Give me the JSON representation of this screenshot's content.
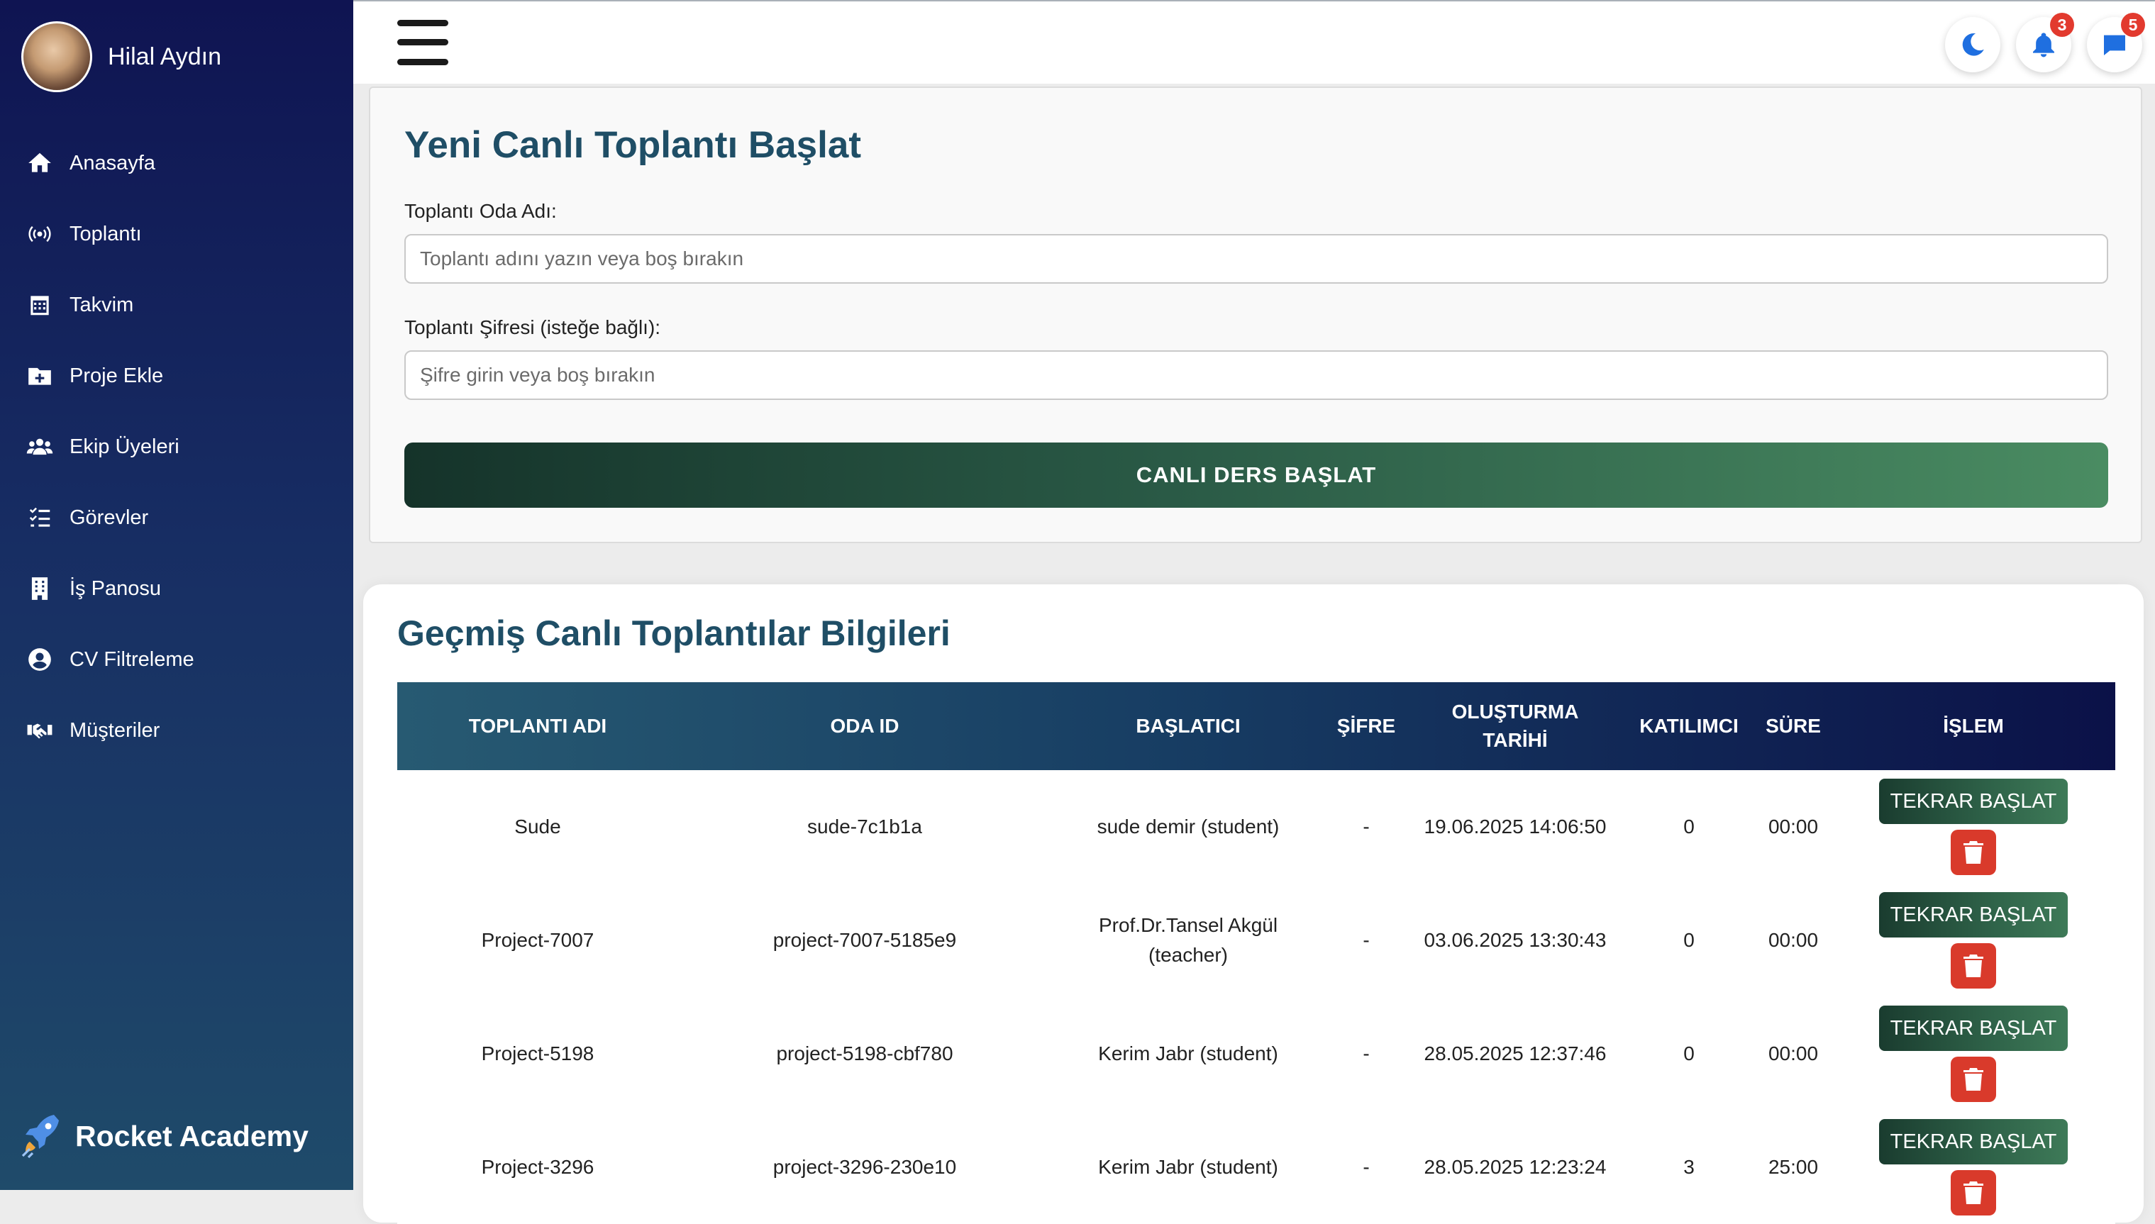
{
  "user": {
    "name": "Hilal Aydın"
  },
  "sidebar": {
    "items": [
      {
        "label": "Anasayfa",
        "icon": "home-icon"
      },
      {
        "label": "Toplantı",
        "icon": "broadcast-icon"
      },
      {
        "label": "Takvim",
        "icon": "calendar-icon"
      },
      {
        "label": "Proje Ekle",
        "icon": "folder-plus-icon"
      },
      {
        "label": "Ekip Üyeleri",
        "icon": "users-icon"
      },
      {
        "label": "Görevler",
        "icon": "task-list-icon"
      },
      {
        "label": "İş Panosu",
        "icon": "building-icon"
      },
      {
        "label": "CV Filtreleme",
        "icon": "user-circle-icon"
      },
      {
        "label": "Müşteriler",
        "icon": "handshake-icon"
      }
    ],
    "brand": "Rocket Academy"
  },
  "topbar": {
    "notifications_count": "3",
    "messages_count": "5"
  },
  "new_meeting": {
    "title": "Yeni Canlı Toplantı Başlat",
    "room_label": "Toplantı Oda Adı:",
    "room_placeholder": "Toplantı adını yazın veya boş bırakın",
    "room_value": "",
    "password_label": "Toplantı Şifresi (isteğe bağlı):",
    "password_placeholder": "Şifre girin veya boş bırakın",
    "password_value": "",
    "start_button": "CANLI DERS BAŞLAT"
  },
  "history": {
    "title": "Geçmiş Canlı Toplantılar Bilgileri",
    "columns": [
      "TOPLANTI ADI",
      "ODA ID",
      "BAŞLATICI",
      "ŞİFRE",
      "OLUŞTURMA TARİHİ",
      "KATILIMCI",
      "SÜRE",
      "İŞLEM"
    ],
    "restart_label": "TEKRAR BAŞLAT",
    "rows": [
      {
        "name": "Sude",
        "room_id": "sude-7c1b1a",
        "starter": "sude demir (student)",
        "password": "-",
        "created": "19.06.2025 14:06:50",
        "participants": "0",
        "duration": "00:00"
      },
      {
        "name": "Project-7007",
        "room_id": "project-7007-5185e9",
        "starter": "Prof.Dr.Tansel Akgül (teacher)",
        "password": "-",
        "created": "03.06.2025 13:30:43",
        "participants": "0",
        "duration": "00:00"
      },
      {
        "name": "Project-5198",
        "room_id": "project-5198-cbf780",
        "starter": "Kerim Jabr (student)",
        "password": "-",
        "created": "28.05.2025 12:37:46",
        "participants": "0",
        "duration": "00:00"
      },
      {
        "name": "Project-3296",
        "room_id": "project-3296-230e10",
        "starter": "Kerim Jabr (student)",
        "password": "-",
        "created": "28.05.2025 12:23:24",
        "participants": "3",
        "duration": "25:00"
      }
    ]
  }
}
